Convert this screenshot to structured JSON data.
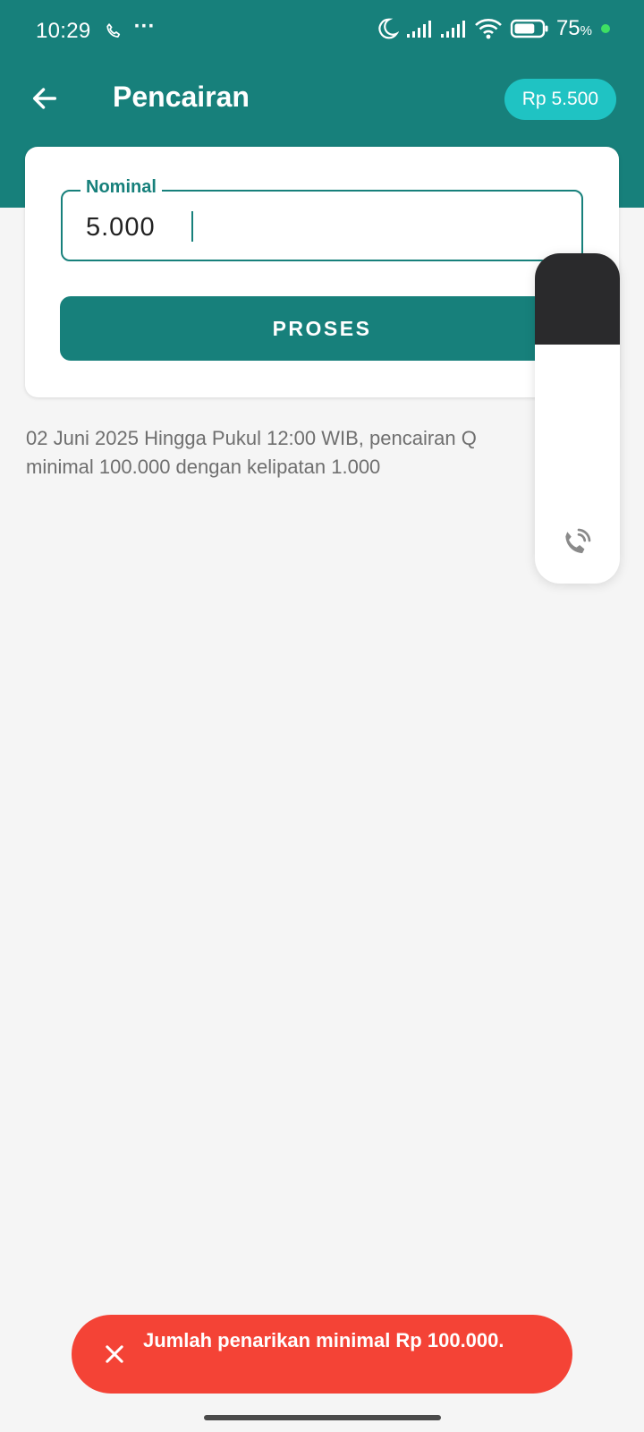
{
  "status_bar": {
    "time": "10:29",
    "more": "···",
    "battery_percent": "75",
    "battery_unit": "%",
    "battery_level": 0.75
  },
  "app_bar": {
    "title": "Pencairan",
    "balance": "Rp 5.500",
    "back_icon": "arrow-left-icon"
  },
  "form": {
    "nominal_label": "Nominal",
    "nominal_value": "5.000",
    "submit_label": "PROSES"
  },
  "info": {
    "line1": "02 Juni 2025 Hingga Pukul 12:00 WIB, pencairan Q",
    "line2": "minimal 100.000 dengan kelipatan 1.000"
  },
  "toast": {
    "message": "Jumlah penarikan minimal Rp 100.000.",
    "close_icon": "close-icon"
  },
  "colors": {
    "primary": "#17807b",
    "balance_pill": "#1fc3c3",
    "error": "#f44336",
    "background": "#f5f5f5"
  }
}
